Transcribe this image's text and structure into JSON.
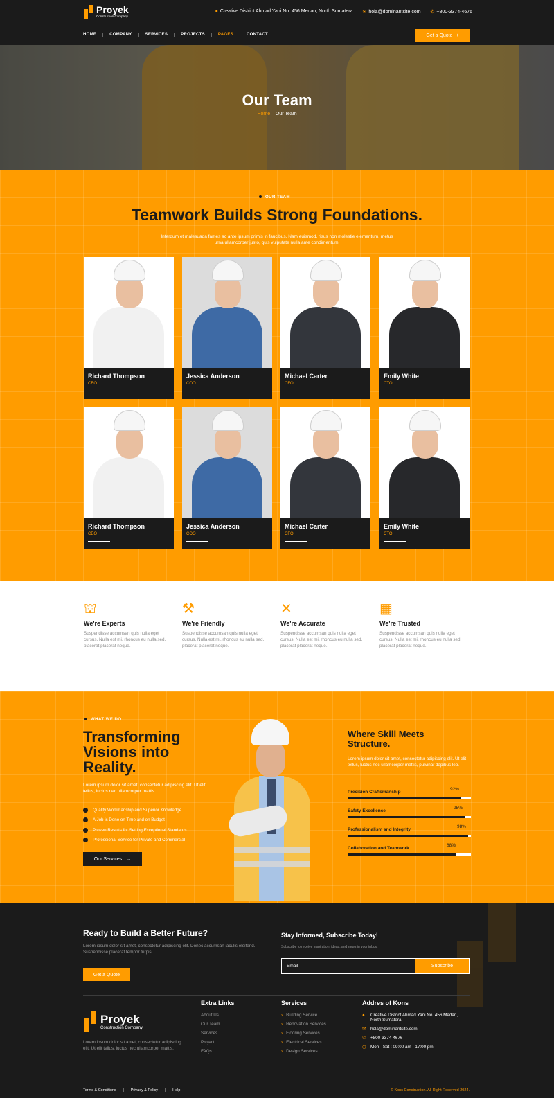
{
  "brand": {
    "name": "Proyek",
    "tagline": "Construction Company"
  },
  "topbar": {
    "address": "Creative District Ahmad Yani No. 456 Medan, North Sumatera",
    "email": "hola@dominantsite.com",
    "phone": "+800-3374-4676"
  },
  "nav": {
    "items": [
      "HOME",
      "COMPANY",
      "SERVICES",
      "PROJECTS",
      "PAGES",
      "CONTACT"
    ],
    "active": "PAGES",
    "quote_label": "Get a Quote"
  },
  "hero": {
    "title": "Our Team",
    "crumb_home": "Home",
    "crumb_sep": " – ",
    "crumb_current": "Our Team"
  },
  "team": {
    "eyebrow": "OUR TEAM",
    "heading": "Teamwork Builds Strong Foundations.",
    "intro": "Interdum et malesuada fames ac ante ipsum primis in faucibus. Nam euismod, risus non molestie elementum, metus urna ullamcorper justo, quis vulputate nulla ante condimentum.",
    "members": [
      {
        "name": "Richard Thompson",
        "role": "CEO"
      },
      {
        "name": "Jessica Anderson",
        "role": "COO"
      },
      {
        "name": "Michael Carter",
        "role": "CFO"
      },
      {
        "name": "Emily White",
        "role": "CTO"
      },
      {
        "name": "Richard Thompson",
        "role": "CEO"
      },
      {
        "name": "Jessica Anderson",
        "role": "COO"
      },
      {
        "name": "Michael Carter",
        "role": "CFO"
      },
      {
        "name": "Emily White",
        "role": "CTO"
      }
    ]
  },
  "features": [
    {
      "icon": "crane-icon",
      "title": "We're Experts",
      "text": "Suspendisse accumsan quis nulla eget cursus. Nulla est mi, rhoncus eu nulla sed, placerat placerat neque."
    },
    {
      "icon": "workers-icon",
      "title": "We're Friendly",
      "text": "Suspendisse accumsan quis nulla eget cursus. Nulla est mi, rhoncus eu nulla sed, placerat placerat neque."
    },
    {
      "icon": "tools-icon",
      "title": "We're Accurate",
      "text": "Suspendisse accumsan quis nulla eget cursus. Nulla est mi, rhoncus eu nulla sed, placerat placerat neque."
    },
    {
      "icon": "bricks-icon",
      "title": "We're Trusted",
      "text": "Suspendisse accumsan quis nulla eget cursus. Nulla est mi, rhoncus eu nulla sed, placerat placerat neque."
    }
  ],
  "what_we_do": {
    "eyebrow": "WHAT WE DO",
    "heading_1": "Transforming",
    "heading_2": "Visions into",
    "heading_3": "Reality.",
    "lead": "Lorem ipsum dolor sit amet, consectetur adipiscing elit. Ut elit tellus, luctus nec ullamcorper mattis.",
    "checks": [
      "Quality Workmanship and Superior Knowledge",
      "A Job is Done on Time and on Budget",
      "Proven Results for Setting Exceptional Standards",
      "Professional Service for Private and Commercial"
    ],
    "button": "Our Services",
    "right_heading": "Where Skill Meets Structure.",
    "right_text": "Lorem ipsum dolor sit amet, consectetur adipiscing elit. Ut elit tellus, luctus nec ullamcorper mattis, pulvinar dapibus leo.",
    "skills": [
      {
        "label": "Precision Craftsmanship",
        "percent": 92,
        "display": "92%"
      },
      {
        "label": "Safety Excellence",
        "percent": 95,
        "display": "95%"
      },
      {
        "label": "Professionalism and Integrity",
        "percent": 98,
        "display": "98%"
      },
      {
        "label": "Collaboration and Teamwork",
        "percent": 88,
        "display": "88%"
      }
    ]
  },
  "footer": {
    "cta_heading": "Ready to Build a Better Future?",
    "cta_text": "Lorem ipsum dolor sit amet, consectetur adipiscing elit. Donec accumsan iaculis eleifend. Suspendisse placerat tempor turpis.",
    "cta_button": "Get a Quote",
    "sub_heading": "Stay Informed, Subscribe Today!",
    "sub_text": "Subscribe to receive inspiration, ideas, and news in your inbox.",
    "email_placeholder": "Email",
    "sub_button": "Subscribe",
    "about": "Lorem ipsum dolor sit amet, consectetur adipiscing elit. Ut elit tellus, luctus nec ullamcorper mattis.",
    "extra_links_title": "Extra Links",
    "extra_links": [
      "About Us",
      "Our Team",
      "Services",
      "Project",
      "FAQs"
    ],
    "services_title": "Services",
    "services": [
      "Building Service",
      "Renovation Services",
      "Flooring Services",
      "Electrical Services",
      "Design Services"
    ],
    "address_title": "Addres of Kons",
    "address_lines": [
      "Creative District Ahmad Yani No. 456 Medan,",
      "North Sumatera"
    ],
    "email": "hola@dominantsite.com",
    "phone": "+800-3374-4676",
    "hours": "Mon - Sat : 09:00 am - 17:00 pm",
    "bottom_links": [
      "Terms & Conditions",
      "Privacy & Policy",
      "Help"
    ],
    "copyright": "© Kons Construction. All Right Reserved 2024."
  },
  "colors": {
    "accent": "#ff9c00",
    "dark": "#1b1b1b"
  }
}
